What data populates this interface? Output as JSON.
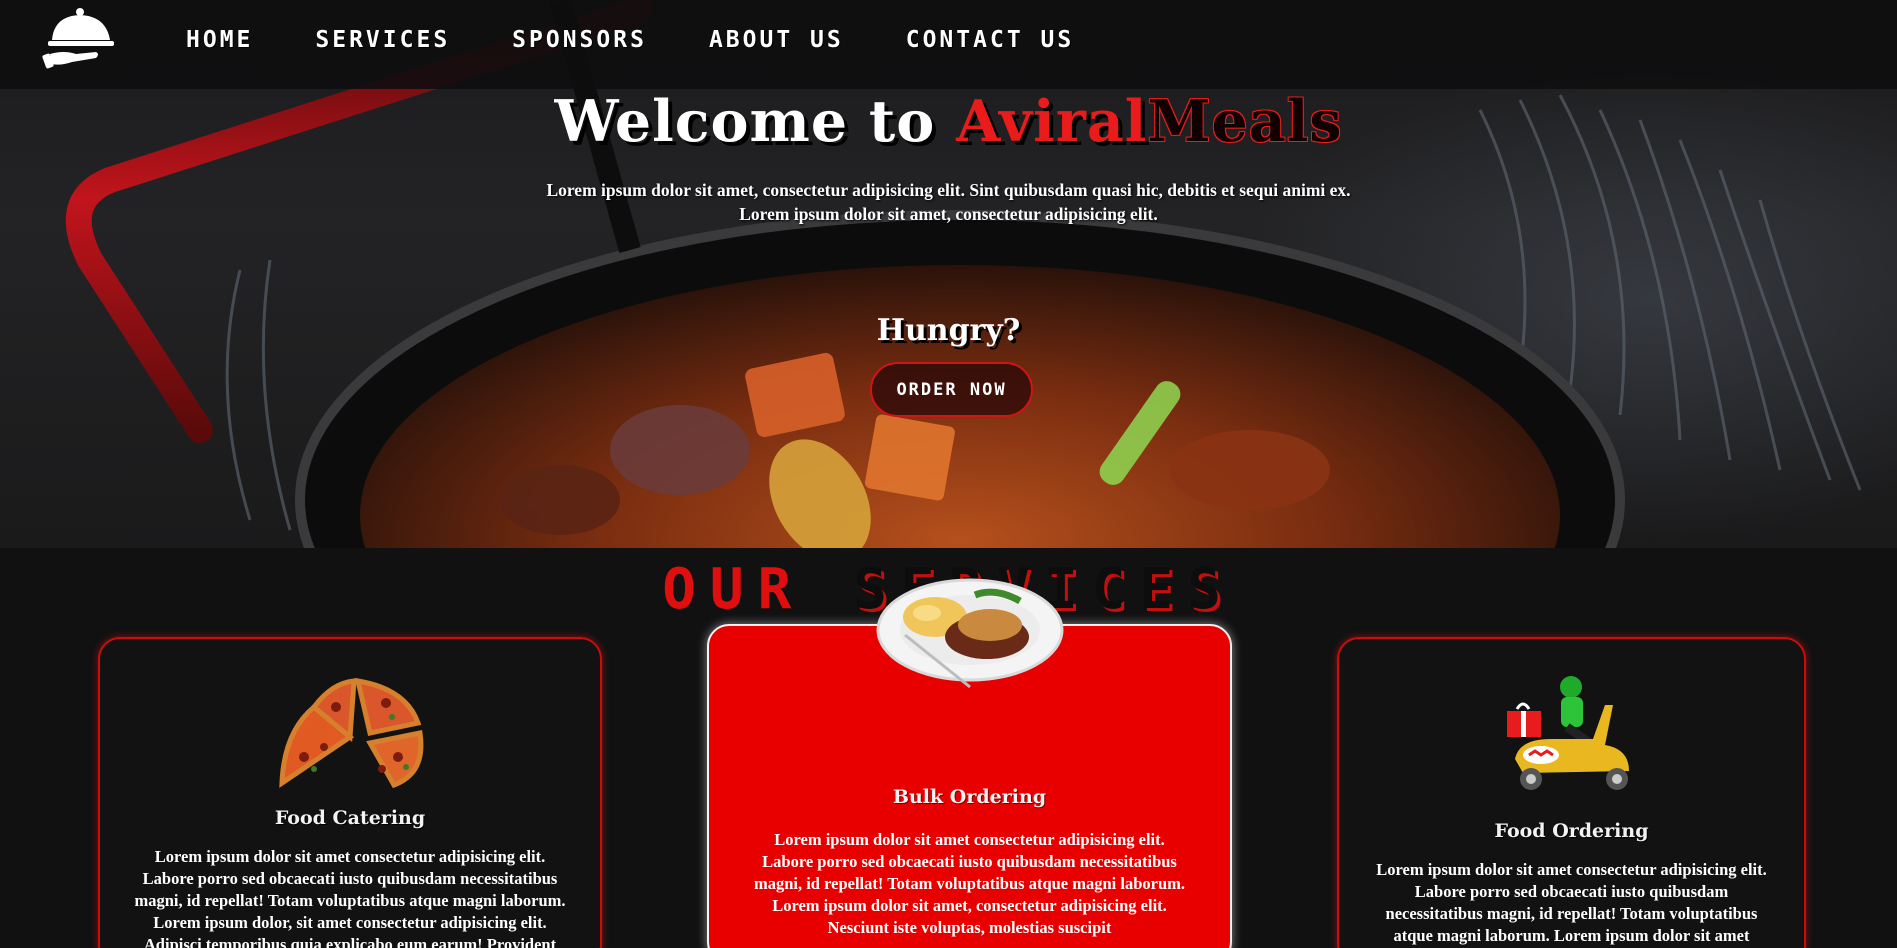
{
  "nav": {
    "logo_icon": "serving-cloche-icon",
    "links": [
      "HOME",
      "SERVICES",
      "SPONSORS",
      "ABOUT US",
      "CONTACT US"
    ]
  },
  "hero": {
    "title_welcome": "Welcome to ",
    "title_brand_first": "Aviral",
    "title_brand_second": "Meals",
    "subtitle_line1": "Lorem ipsum dolor sit amet, consectetur adipisicing elit. Sint quibusdam quasi hic, debitis et sequi animi ex.",
    "subtitle_line2": "Lorem ipsum dolor sit amet, consectetur adipisicing elit.",
    "hungry": "Hungry?",
    "order_button": "ORDER NOW"
  },
  "services": {
    "title_first": "OUR",
    "title_second": "SERVICES",
    "cards": [
      {
        "title": "Food Catering",
        "icon": "pizza-icon",
        "text": "Lorem ipsum dolor sit amet consectetur adipisicing elit. Labore porro sed obcaecati iusto quibusdam necessitatibus magni, id repellat! Totam voluptatibus atque magni laborum. Lorem ipsum dolor, sit amet consectetur adipisicing elit. Adipisci temporibus quia explicabo eum earum! Provident"
      },
      {
        "title": "Bulk Ordering",
        "icon": "plate-of-food-icon",
        "text": "Lorem ipsum dolor sit amet consectetur adipisicing elit. Labore porro sed obcaecati iusto quibusdam necessitatibus magni, id repellat! Totam voluptatibus atque magni laborum. Lorem ipsum dolor sit amet, consectetur adipisicing elit. Nesciunt iste voluptas, molestias suscipit"
      },
      {
        "title": "Food Ordering",
        "icon": "delivery-scooter-icon",
        "text": "Lorem ipsum dolor sit amet consectetur adipisicing elit. Labore porro sed obcaecati iusto quibusdam necessitatibus magni, id repellat! Totam voluptatibus atque magni laborum. Lorem ipsum dolor sit amet"
      }
    ]
  },
  "colors": {
    "accent_red": "#e00f0f",
    "background": "#111112"
  }
}
